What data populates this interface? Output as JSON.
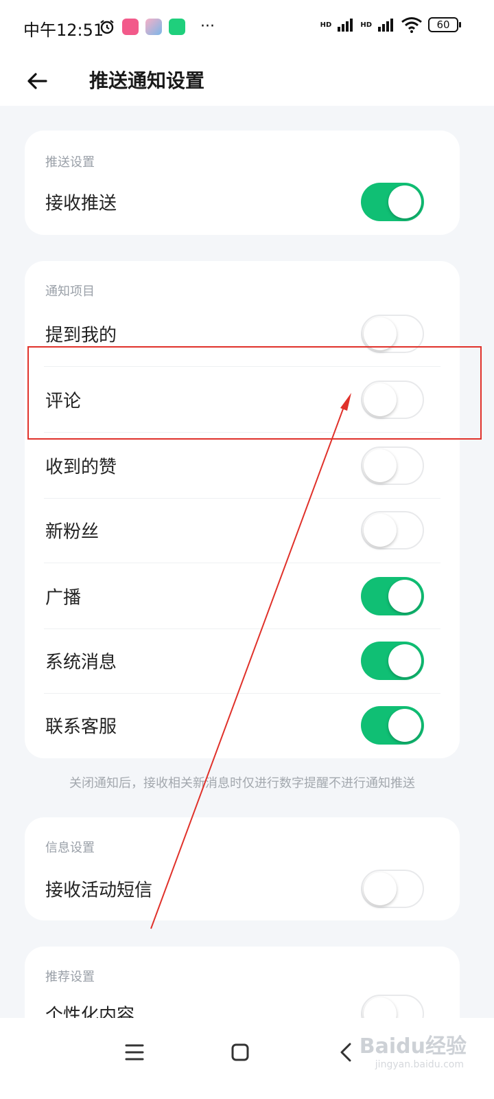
{
  "status_bar": {
    "time": "中午12:51",
    "more": "···",
    "signal1": "HD",
    "signal2": "HD",
    "battery": "60"
  },
  "header": {
    "title": "推送通知设置"
  },
  "push_section": {
    "title": "推送设置",
    "rows": [
      {
        "label": "接收推送",
        "enabled": true
      }
    ]
  },
  "notify_section": {
    "title": "通知项目",
    "rows": [
      {
        "label": "提到我的",
        "enabled": false
      },
      {
        "label": "评论",
        "enabled": false
      },
      {
        "label": "收到的赞",
        "enabled": false
      },
      {
        "label": "新粉丝",
        "enabled": false
      },
      {
        "label": "广播",
        "enabled": true
      },
      {
        "label": "系统消息",
        "enabled": true
      },
      {
        "label": "联系客服",
        "enabled": true
      }
    ]
  },
  "hint": "关闭通知后，接收相关新消息时仅进行数字提醒不进行通知推送",
  "info_section": {
    "title": "信息设置",
    "rows": [
      {
        "label": "接收活动短信",
        "enabled": false
      }
    ]
  },
  "recommend_section": {
    "title": "推荐设置",
    "rows": [
      {
        "label": "个性化内容",
        "enabled": false
      }
    ]
  },
  "watermark": {
    "text": "Baidu经验",
    "sub": "jingyan.baidu.com"
  },
  "colors": {
    "accent": "#10bf74",
    "annotation": "#e0312a"
  }
}
